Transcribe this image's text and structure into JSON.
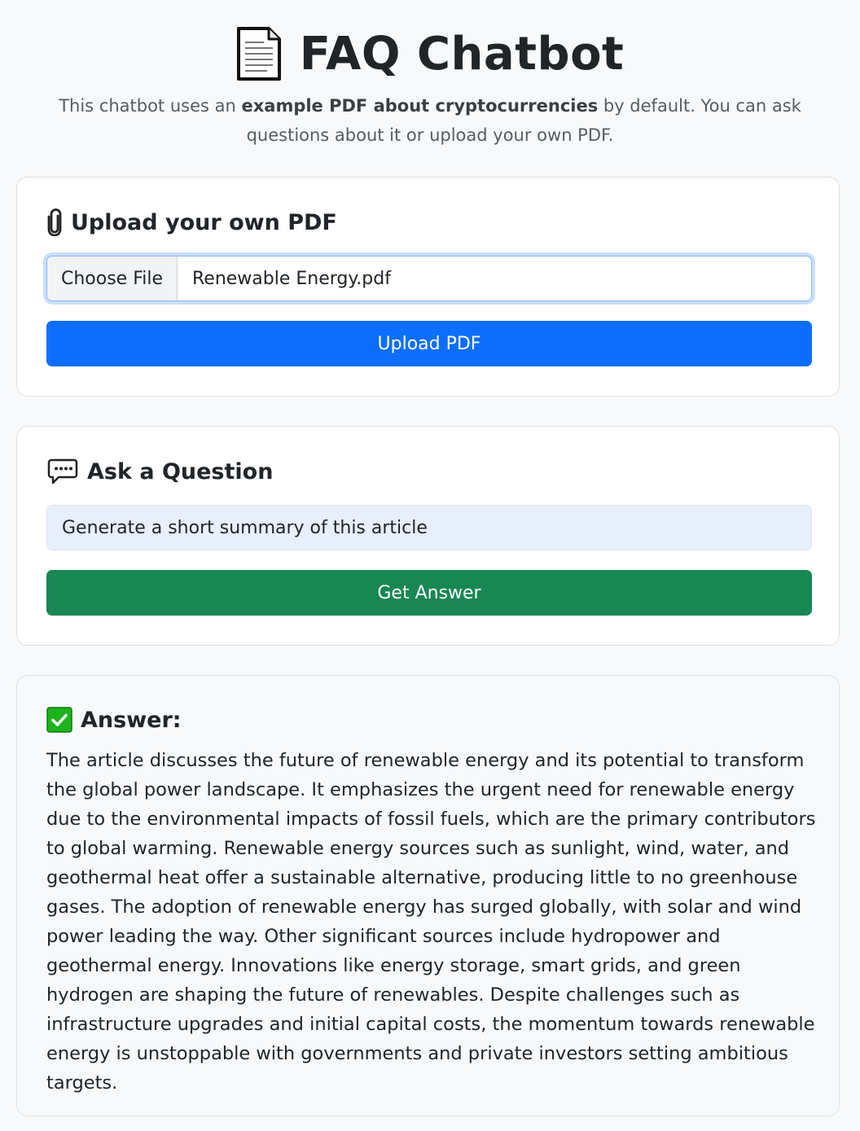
{
  "header": {
    "icon": "page-facing-up-icon",
    "title": "FAQ Chatbot",
    "subtitle_pre": "This chatbot uses an ",
    "subtitle_bold": "example PDF about cryptocurrencies",
    "subtitle_post": " by default. You can ask questions about it or upload your own PDF."
  },
  "upload": {
    "icon": "paperclip-icon",
    "title": "Upload your own PDF",
    "choose_label": "Choose File",
    "file_name": "Renewable Energy.pdf",
    "button_label": "Upload PDF"
  },
  "ask": {
    "icon": "speech-bubble-icon",
    "title": "Ask a Question",
    "input_value": "Generate a short summary of this article",
    "button_label": "Get Answer"
  },
  "answer": {
    "icon": "check-mark-icon",
    "title": "Answer:",
    "text": "The article discusses the future of renewable energy and its potential to transform the global power landscape. It emphasizes the urgent need for renewable energy due to the environmental impacts of fossil fuels, which are the primary contributors to global warming. Renewable energy sources such as sunlight, wind, water, and geothermal heat offer a sustainable alternative, producing little to no greenhouse gases. The adoption of renewable energy has surged globally, with solar and wind power leading the way. Other significant sources include hydropower and geothermal energy. Innovations like energy storage, smart grids, and green hydrogen are shaping the future of renewables. Despite challenges such as infrastructure upgrades and initial capital costs, the momentum towards renewable energy is unstoppable with governments and private investors setting ambitious targets."
  },
  "colors": {
    "primary": "#0d6efd",
    "success": "#198754",
    "background": "#f8f9fa"
  }
}
